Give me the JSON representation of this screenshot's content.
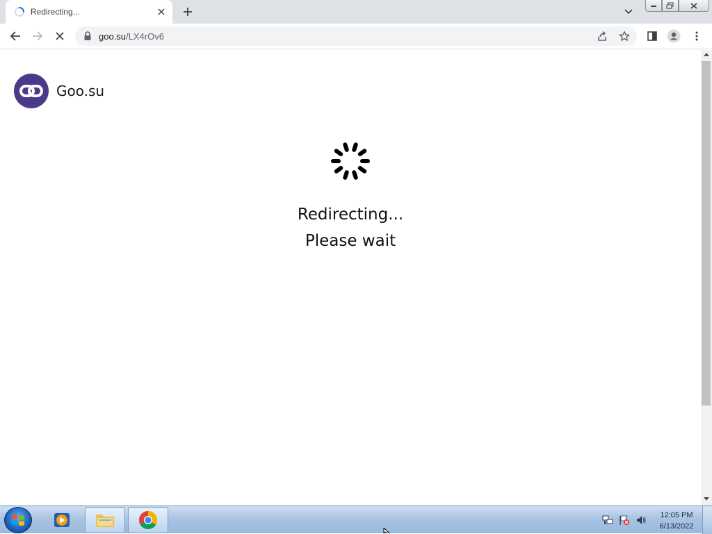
{
  "browser": {
    "tab": {
      "title": "Redirecting...",
      "loading_icon": "loading-spinner-icon",
      "close_icon": "close-icon"
    },
    "new_tab_icon": "plus-icon",
    "tab_search_icon": "chevron-down-icon",
    "window_controls": [
      "minimize-icon",
      "restore-icon",
      "close-icon"
    ],
    "toolbar": {
      "back_icon": "arrow-left-icon",
      "forward_icon": "arrow-right-icon",
      "stop_icon": "stop-x-icon",
      "url_host": "goo.su",
      "url_path": "/LX4rOv6",
      "lock_icon": "lock-icon",
      "share_icon": "share-icon",
      "bookmark_icon": "star-icon",
      "side_panel_icon": "side-panel-icon",
      "profile_icon": "profile-icon",
      "menu_icon": "kebab-menu-icon"
    }
  },
  "page": {
    "brand_name": "Goo.su",
    "logo_icon": "link-icon",
    "accent_color": "#4b3a8a",
    "spinner_icon": "loading-spinner-icon",
    "message_line1": "Redirecting...",
    "message_line2": "Please wait"
  },
  "taskbar": {
    "start_icon": "windows-logo-icon",
    "pinned": [
      "media-player-icon",
      "file-explorer-icon",
      "chrome-icon"
    ],
    "tray": [
      "network-icon",
      "action-center-flag-icon",
      "volume-icon"
    ],
    "clock_time": "12:05 PM",
    "clock_date": "6/13/2022"
  }
}
